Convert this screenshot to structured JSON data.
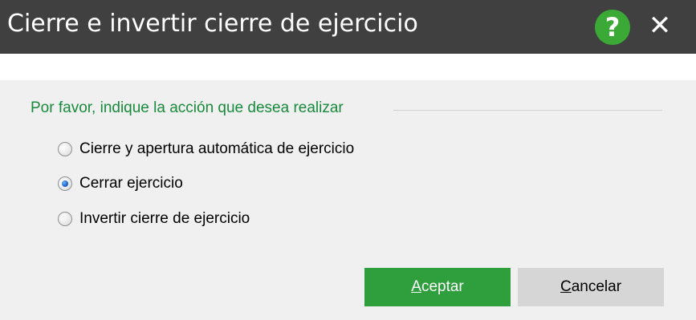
{
  "window": {
    "title": "Cierre e invertir cierre de ejercicio",
    "help_glyph": "?",
    "close_glyph": "✕"
  },
  "group": {
    "label": "Por favor, indique la acción que desea realizar"
  },
  "options": [
    {
      "label": "Cierre y apertura automática de ejercicio",
      "selected": false
    },
    {
      "label": "Cerrar ejercicio",
      "selected": true
    },
    {
      "label": "Invertir cierre de ejercicio",
      "selected": false
    }
  ],
  "buttons": {
    "accept": {
      "mnemonic": "A",
      "rest": "ceptar"
    },
    "cancel": {
      "mnemonic": "C",
      "rest": "ancelar"
    }
  },
  "colors": {
    "titlebar": "#404040",
    "accent_green": "#2f9e3d",
    "group_label": "#188a3c",
    "panel": "#f0f0f0"
  },
  "icons": {
    "help": "help-icon",
    "close": "close-icon"
  }
}
